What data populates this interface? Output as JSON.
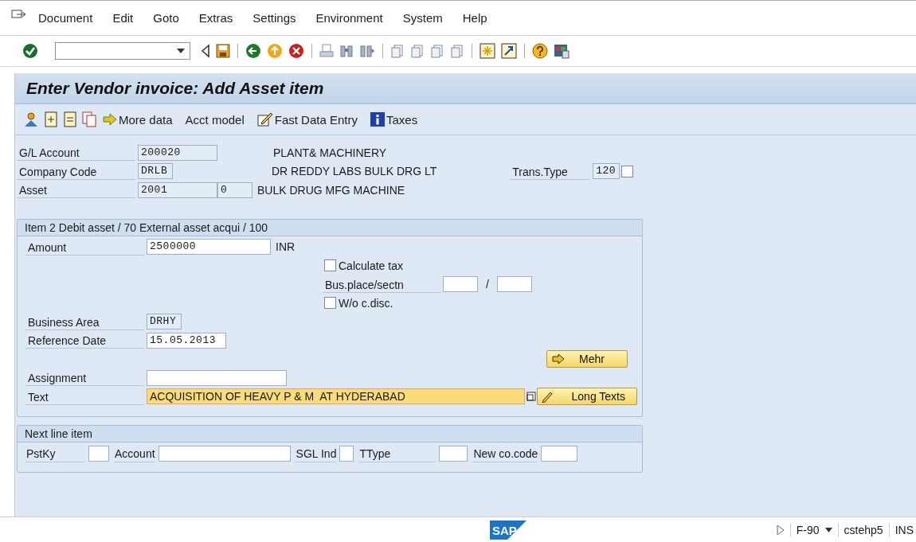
{
  "menu": [
    {
      "label": "Document"
    },
    {
      "label": "Edit"
    },
    {
      "label": "Goto"
    },
    {
      "label": "Extras"
    },
    {
      "label": "Settings"
    },
    {
      "label": "Environment"
    },
    {
      "label": "System"
    },
    {
      "label": "Help"
    }
  ],
  "title": "Enter Vendor invoice: Add Asset item",
  "app_toolbar": [
    {
      "label": "More data",
      "kind": "arrow"
    },
    {
      "label": "Acct model",
      "kind": "plain"
    },
    {
      "label": "Fast Data Entry",
      "kind": "edit"
    },
    {
      "label": "Taxes",
      "kind": "info"
    }
  ],
  "header_fields": [
    {
      "label": "G/L Account",
      "value": "200020",
      "description": "PLANT& MACHINERY"
    },
    {
      "label": "Company Code",
      "value": "DRLB",
      "description": "DR REDDY LABS BULK DRG LT"
    },
    {
      "label": "Asset",
      "value": "2001",
      "sub_value": "0",
      "description": "BULK DRUG MFG MACHINE"
    }
  ],
  "trans_type": {
    "label": "Trans.Type",
    "value": "120",
    "checked": false
  },
  "item_group": {
    "title": "Item 2 Debit asset / 70 External asset acqui / 100",
    "amount": {
      "label": "Amount",
      "value": "2500000",
      "unit": "INR"
    },
    "calculate_tax": {
      "label": "Calculate tax",
      "checked": false
    },
    "bus_place": {
      "label": "Bus.place/sectn",
      "separator": "/"
    },
    "wo_cdisc": {
      "label": "W/o c.disc.",
      "checked": false
    },
    "business_area": {
      "label": "Business Area",
      "value": "DRHY"
    },
    "reference_date": {
      "label": "Reference Date",
      "value": "15.05.2013"
    },
    "mehr_button": {
      "label": "Mehr"
    },
    "assignment": {
      "label": "Assignment"
    },
    "text": {
      "label": "Text",
      "value": "ACQUISITION OF HEAVY P & M  AT HYDERABAD"
    },
    "long_texts_button": {
      "label": "Long Texts"
    }
  },
  "next_line_item": {
    "title": "Next line item",
    "fields": [
      {
        "label": "PstKy"
      },
      {
        "label": "Account"
      },
      {
        "label": "SGL Ind"
      },
      {
        "label": "TType"
      },
      {
        "label": "New co.code"
      }
    ]
  },
  "status_bar": {
    "logo": "SAP",
    "transaction": "F-90",
    "user": "cstehp5",
    "mode": "INS"
  }
}
